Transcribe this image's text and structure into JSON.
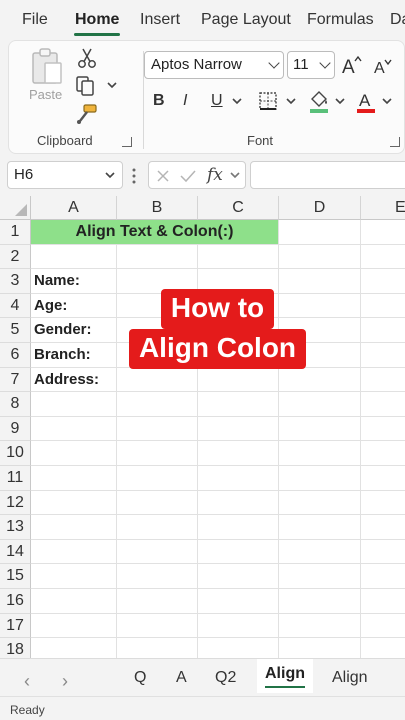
{
  "menu": {
    "items": [
      "File",
      "Home",
      "Insert",
      "Page Layout",
      "Formulas",
      "Da"
    ],
    "active": "Home"
  },
  "ribbon": {
    "clipboard": {
      "paste_label": "Paste",
      "group_label": "Clipboard"
    },
    "font": {
      "font_name": "Aptos Narrow",
      "font_size": "11",
      "bold": "B",
      "italic": "I",
      "underline": "U",
      "grow": "A",
      "shrink": "A",
      "color_glyph": "A",
      "group_label": "Font"
    }
  },
  "formula_bar": {
    "name_box": "H6",
    "fx_label": "fx",
    "formula": ""
  },
  "grid": {
    "columns": [
      "A",
      "B",
      "C",
      "D",
      "E"
    ],
    "rows": [
      "1",
      "2",
      "3",
      "4",
      "5",
      "6",
      "7",
      "8",
      "9",
      "10",
      "11",
      "12",
      "13",
      "14",
      "15",
      "16",
      "17",
      "18"
    ],
    "cells": {
      "A1": "Align Text & Colon(:)",
      "A3": "Name:",
      "A4": "Age:",
      "A5": "Gender:",
      "A6": "Branch:",
      "A7": "Address:"
    }
  },
  "overlay": {
    "line1": "How to",
    "line2": "Align Colon"
  },
  "sheet_tabs": {
    "tabs": [
      "Q",
      "A",
      "Q2",
      "Align",
      "Align"
    ],
    "active_index": 3
  },
  "status": {
    "text": "Ready"
  },
  "colors": {
    "accent": "#217346",
    "title_fill": "#8ee08a",
    "caption_red": "#e41b1b",
    "font_color_bar": "#e41b1b",
    "fill_color_bar": "#59c07a"
  }
}
